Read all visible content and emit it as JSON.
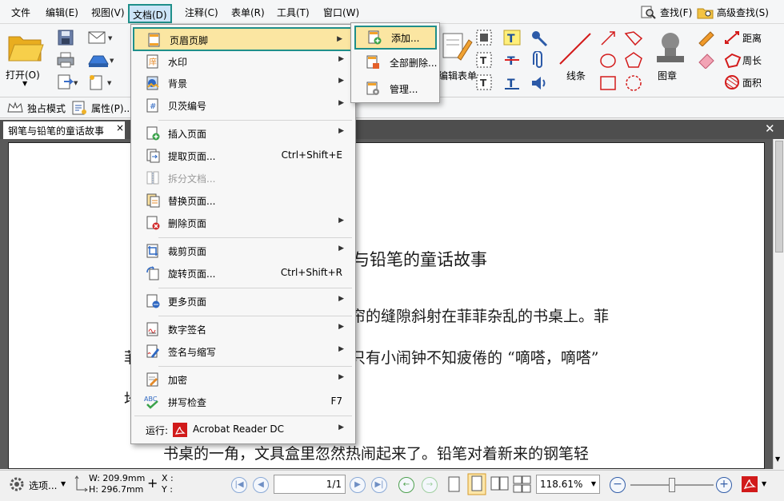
{
  "menubar": {
    "items": [
      "文件",
      "编辑(E)",
      "视图(V)",
      "文档(D)",
      "注释(C)",
      "表单(R)",
      "工具(T)",
      "窗口(W)"
    ],
    "find": "查找(F)",
    "advanced_find": "高级查找(S)"
  },
  "ribbon": {
    "open": "打开(O)",
    "edit_form": "编辑表单",
    "lines": "线条",
    "stamp": "图章",
    "distance": "距离",
    "perimeter": "周长",
    "area": "面积"
  },
  "toolbar2": {
    "exclusive_mode": "独占模式",
    "properties": "属性(P)..."
  },
  "tab": {
    "title": "钢笔与铅笔的童话故事",
    "close": "×"
  },
  "document": {
    "title_fragment": "与铅笔的童话故事",
    "line1": "帘的缝隙斜射在菲菲杂乱的书桌上。菲",
    "line2_left": "菲",
    "line2": "只有小闹钟不知疲倦的 “嘀嗒，嘀嗒”",
    "line3_left": "地",
    "line4": "书桌的一角，文具盒里忽然热闹起来了。铅笔对着新来的钢笔轻"
  },
  "doc_menu": {
    "items": [
      {
        "label": "页眉页脚",
        "arrow": "▶"
      },
      {
        "label": "水印",
        "arrow": "▶"
      },
      {
        "label": "背景",
        "arrow": "▶"
      },
      {
        "label": "贝茨编号",
        "arrow": "▶"
      },
      {
        "label": "插入页面",
        "arrow": "▶"
      },
      {
        "label": "提取页面...",
        "shortcut": "Ctrl+Shift+E"
      },
      {
        "label": "拆分文档..."
      },
      {
        "label": "替换页面..."
      },
      {
        "label": "删除页面",
        "arrow": "▶"
      },
      {
        "label": "裁剪页面",
        "arrow": "▶"
      },
      {
        "label": "旋转页面...",
        "shortcut": "Ctrl+Shift+R"
      },
      {
        "label": "更多页面",
        "arrow": "▶"
      },
      {
        "label": "数字签名",
        "arrow": "▶"
      },
      {
        "label": "签名与缩写",
        "arrow": "▶"
      },
      {
        "label": "加密",
        "arrow": "▶"
      },
      {
        "label": "拼写检查",
        "shortcut": "F7"
      },
      {
        "label": "运行:",
        "app": "Acrobat Reader DC",
        "arrow": "▶"
      }
    ]
  },
  "submenu": {
    "items": [
      "添加...",
      "全部删除...",
      "管理..."
    ]
  },
  "statusbar": {
    "options": "选项...",
    "width": "W: 209.9mm",
    "height": "H: 296.7mm",
    "x": "X :",
    "y": "Y :",
    "page": "1/1",
    "zoom": "118.61%"
  },
  "colors": {
    "highlight_border": "#1f8f8a",
    "highlight_fill": "#fbe6a2",
    "adobe_red": "#d11a1a",
    "tab_bar": "#4e4e4e"
  }
}
